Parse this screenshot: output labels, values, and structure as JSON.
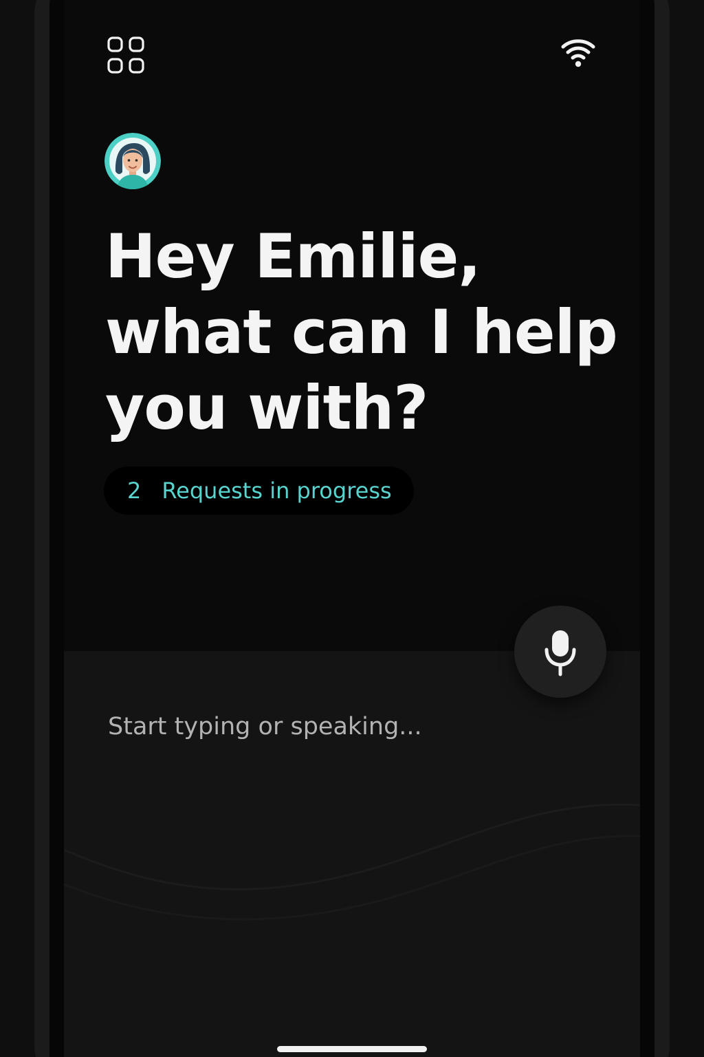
{
  "header": {
    "menu_icon": "apps-grid-icon",
    "status_icon": "wifi-icon"
  },
  "assistant": {
    "avatar_icon": "avatar-woman-icon"
  },
  "greeting": {
    "line1": "Hey Emilie,",
    "line2": "what can I help",
    "line3": "you with?"
  },
  "requests": {
    "count": "2",
    "label": "Requests in progress"
  },
  "input": {
    "placeholder": "Start typing or speaking...",
    "mic_icon": "microphone-icon"
  },
  "colors": {
    "accent": "#59d3ce",
    "background": "#0a0a0a",
    "panel": "#141414",
    "text_primary": "#f4f4f4",
    "text_secondary": "#b3b3b3"
  }
}
